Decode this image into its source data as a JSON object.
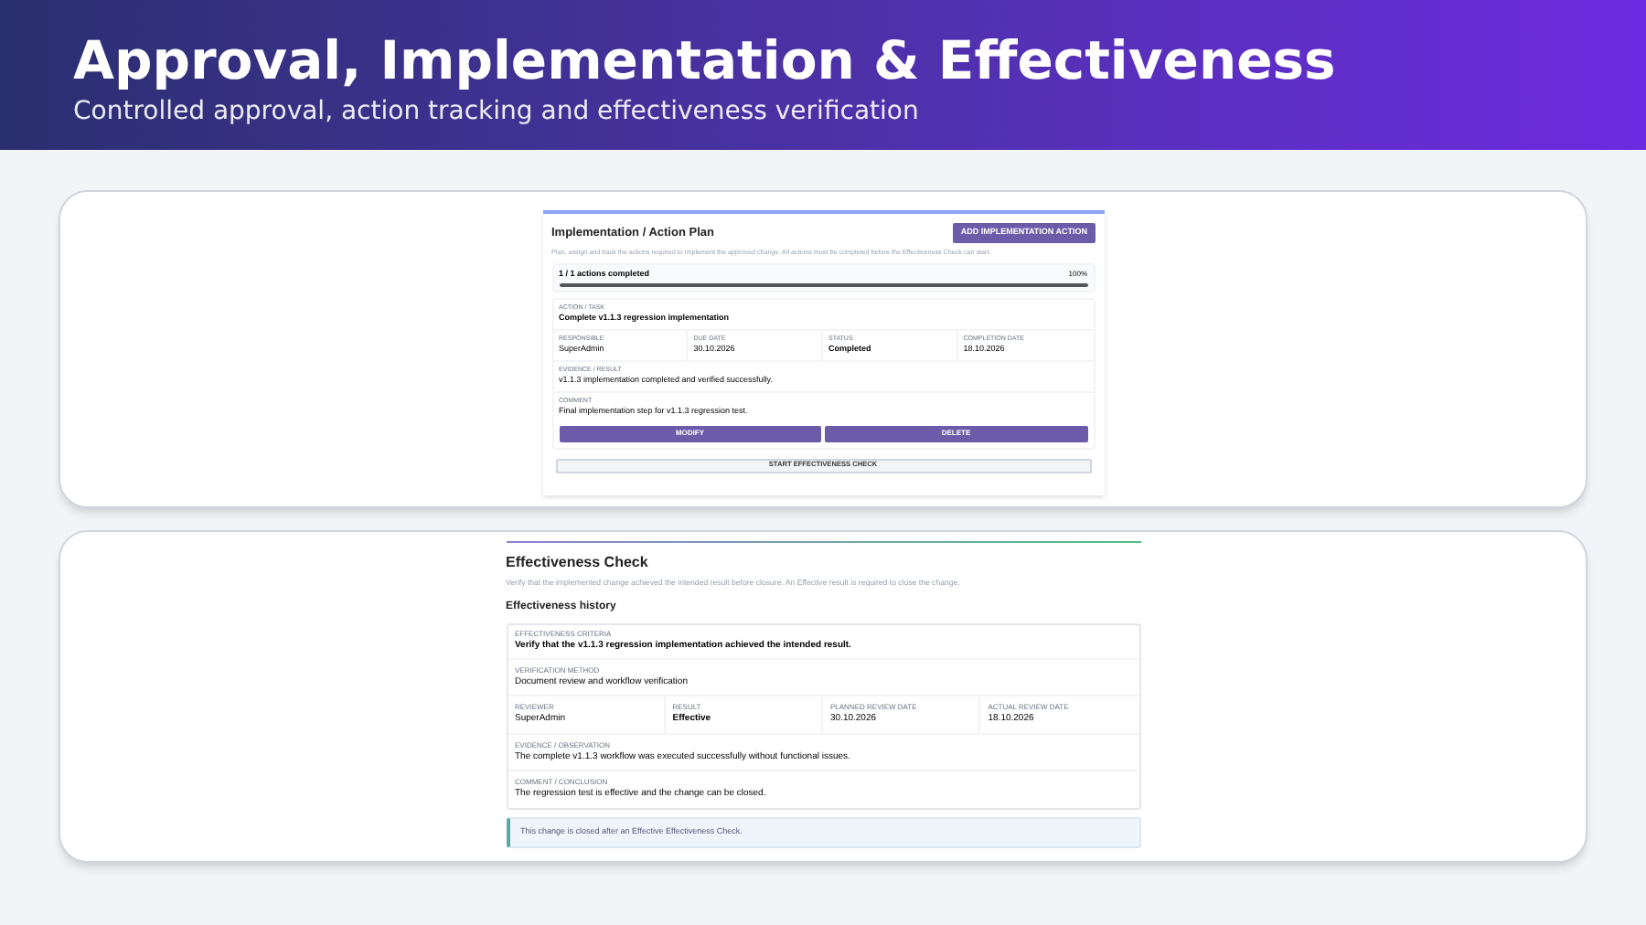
{
  "header": {
    "title": "Approval, Implementation & Effectiveness",
    "subtitle": "Controlled approval, action tracking and effectiveness verification"
  },
  "plan": {
    "title": "Implementation / Action Plan",
    "add_button": "ADD IMPLEMENTATION ACTION",
    "description": "Plan, assign and track the actions required to implement the approved change. All actions must be completed before the Effectiveness Check can start.",
    "progress": {
      "label": "1 / 1 actions completed",
      "percent": "100%",
      "level": 1
    },
    "action": {
      "task_label": "ACTION / TASK",
      "task": "Complete v1.1.3 regression implementation",
      "fields": [
        {
          "label": "RESPONSIBLE",
          "value": "SuperAdmin",
          "emphasis": false
        },
        {
          "label": "DUE DATE",
          "value": "30.10.2026",
          "emphasis": false
        },
        {
          "label": "STATUS",
          "value": "Completed",
          "emphasis": true
        },
        {
          "label": "COMPLETION DATE",
          "value": "18.10.2026",
          "emphasis": false
        }
      ],
      "evidence_label": "EVIDENCE / RESULT",
      "evidence": "v1.1.3 implementation completed and verified successfully.",
      "comment_label": "COMMENT",
      "comment": "Final implementation step for v1.1.3 regression test.",
      "buttons": [
        "MODIFY",
        "DELETE"
      ]
    },
    "start_button": "START EFFECTIVENESS CHECK"
  },
  "check": {
    "title": "Effectiveness Check",
    "description": "Verify that the implemented change achieved the intended result before closure. An Effective result is required to close the change.",
    "history_title": "Effectiveness history",
    "criteria_label": "EFFECTIVENESS CRITERIA",
    "criteria": "Verify that the v1.1.3 regression implementation achieved the intended result.",
    "method_label": "VERIFICATION METHOD",
    "method": "Document review and workflow verification",
    "fields": [
      {
        "label": "REVIEWER",
        "value": "SuperAdmin",
        "emphasis": false
      },
      {
        "label": "RESULT",
        "value": "Effective",
        "emphasis": true
      },
      {
        "label": "PLANNED REVIEW DATE",
        "value": "30.10.2026",
        "emphasis": false
      },
      {
        "label": "ACTUAL REVIEW DATE",
        "value": "18.10.2026",
        "emphasis": false
      }
    ],
    "evidence_label": "EVIDENCE / OBSERVATION",
    "evidence": "The complete v1.1.3 workflow was executed successfully without functional issues.",
    "comment_label": "COMMENT / CONCLUSION",
    "comment": "The regression test is effective and the change can be closed.",
    "notice": "This change is closed after an Effective Effectiveness Check."
  }
}
